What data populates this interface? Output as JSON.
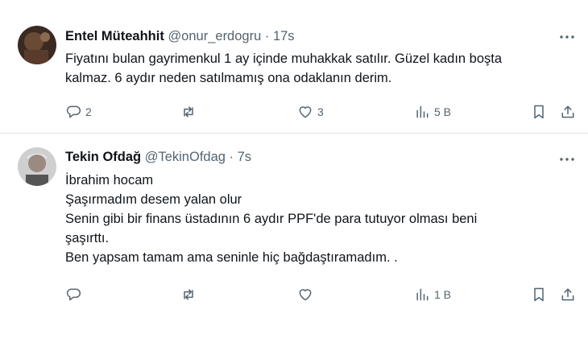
{
  "tweets": [
    {
      "name": "Entel Müteahhit",
      "handle": "@onur_erdogru",
      "separator": "·",
      "time": "17s",
      "lines": [
        "Fiyatını bulan gayrimenkul 1 ay içinde muhakkak satılır. Güzel kadın boşta",
        "kalmaz. 6 aydır neden satılmamış ona odaklanın derim."
      ],
      "replies": "2",
      "retweets": "",
      "likes": "3",
      "views": "5 B"
    },
    {
      "name": "Tekin Ofdağ",
      "handle": "@TekinOfdag",
      "separator": "·",
      "time": "7s",
      "lines": [
        "İbrahim hocam",
        "Şaşırmadım desem yalan olur",
        "Senin gibi bir finans üstadının 6 aydır PPF'de para tutuyor olması beni",
        "şaşırttı.",
        "Ben yapsam tamam ama seninle hiç bağdaştıramadım. ."
      ],
      "replies": "",
      "retweets": "",
      "likes": "",
      "views": "1 B"
    }
  ],
  "icons": {
    "reply": "reply-icon",
    "retweet": "retweet-icon",
    "like": "heart-icon",
    "views": "views-bar-icon",
    "bookmark": "bookmark-icon",
    "share": "share-icon",
    "more": "more-dots-icon"
  },
  "colors": {
    "text": "#0f1419",
    "secondary": "#536471",
    "divider": "#e1e6ea"
  }
}
